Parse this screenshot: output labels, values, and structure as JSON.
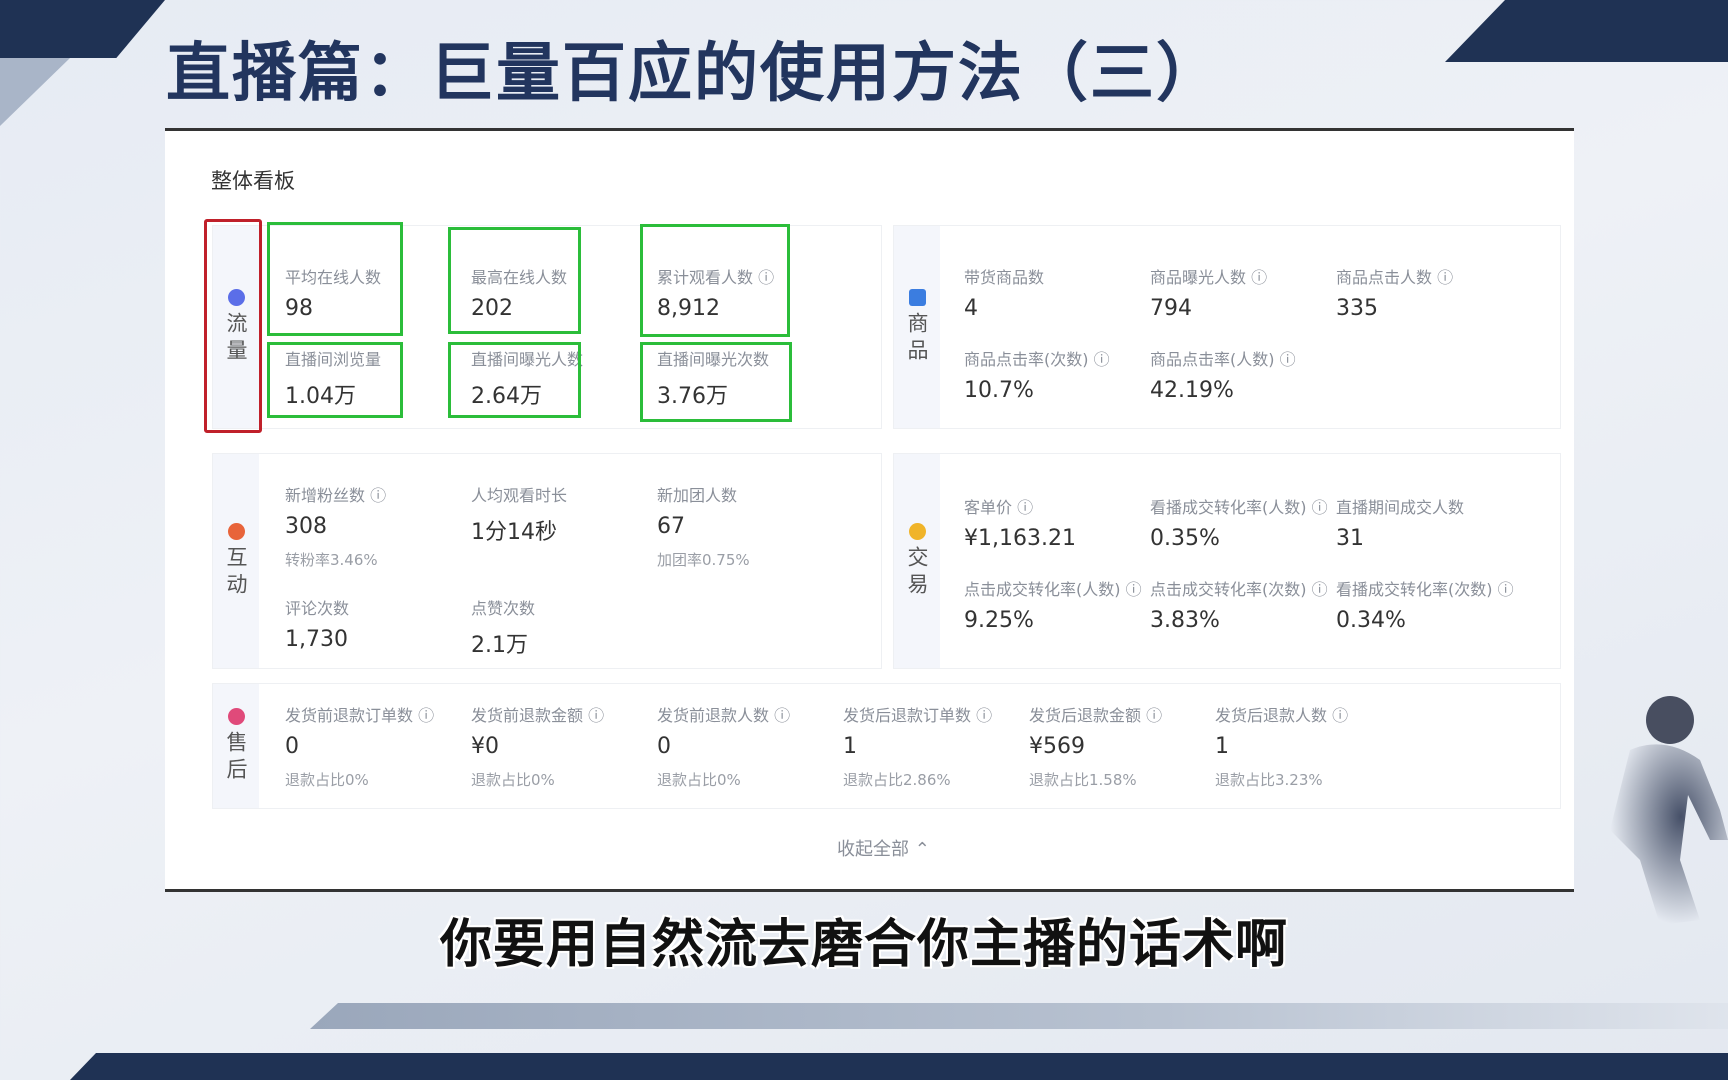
{
  "slide": {
    "title": "直播篇：巨量百应的使用方法（三）",
    "caption": "你要用自然流去磨合你主播的话术啊"
  },
  "dashboard": {
    "title": "整体看板",
    "collapse_label": "收起全部 ⌃",
    "traffic": {
      "category": "流量",
      "icon": "traffic-icon",
      "metrics": [
        {
          "label": "平均在线人数",
          "value": "98"
        },
        {
          "label": "最高在线人数",
          "value": "202"
        },
        {
          "label": "累计观看人数 ⓘ",
          "value": "8,912"
        },
        {
          "label": "直播间浏览量",
          "value": "1.04万"
        },
        {
          "label": "直播间曝光人数",
          "value": "2.64万"
        },
        {
          "label": "直播间曝光次数",
          "value": "3.76万"
        }
      ]
    },
    "products": {
      "category": "商品",
      "icon": "product-icon",
      "metrics": [
        {
          "label": "带货商品数",
          "value": "4"
        },
        {
          "label": "商品曝光人数 ⓘ",
          "value": "794"
        },
        {
          "label": "商品点击人数 ⓘ",
          "value": "335"
        },
        {
          "label": "商品点击率(次数) ⓘ",
          "value": "10.7%"
        },
        {
          "label": "商品点击率(人数) ⓘ",
          "value": "42.19%"
        }
      ]
    },
    "interaction": {
      "category": "互动",
      "icon": "interaction-icon",
      "metrics": [
        {
          "label": "新增粉丝数 ⓘ",
          "value": "308",
          "sub": "转粉率3.46%"
        },
        {
          "label": "人均观看时长",
          "value": "1分14秒"
        },
        {
          "label": "新加团人数",
          "value": "67",
          "sub": "加团率0.75%"
        },
        {
          "label": "评论次数",
          "value": "1,730"
        },
        {
          "label": "点赞次数",
          "value": "2.1万"
        }
      ]
    },
    "trade": {
      "category": "交易",
      "icon": "trade-icon",
      "metrics": [
        {
          "label": "客单价 ⓘ",
          "value": "¥1,163.21"
        },
        {
          "label": "看播成交转化率(人数) ⓘ",
          "value": "0.35%"
        },
        {
          "label": "直播期间成交人数",
          "value": "31"
        },
        {
          "label": "点击成交转化率(人数) ⓘ",
          "value": "9.25%"
        },
        {
          "label": "点击成交转化率(次数) ⓘ",
          "value": "3.83%"
        },
        {
          "label": "看播成交转化率(次数) ⓘ",
          "value": "0.34%"
        }
      ]
    },
    "aftersale": {
      "category": "售后",
      "icon": "aftersale-icon",
      "metrics": [
        {
          "label": "发货前退款订单数 ⓘ",
          "value": "0",
          "sub": "退款占比0%"
        },
        {
          "label": "发货前退款金额 ⓘ",
          "value": "¥0",
          "sub": "退款占比0%"
        },
        {
          "label": "发货前退款人数 ⓘ",
          "value": "0",
          "sub": "退款占比0%"
        },
        {
          "label": "发货后退款订单数 ⓘ",
          "value": "1",
          "sub": "退款占比2.86%"
        },
        {
          "label": "发货后退款金额 ⓘ",
          "value": "¥569",
          "sub": "退款占比1.58%"
        },
        {
          "label": "发货后退款人数 ⓘ",
          "value": "1",
          "sub": "退款占比3.23%"
        }
      ]
    }
  },
  "colors": {
    "title": "#22355e",
    "highlight_green": "#2bbd3a",
    "highlight_red": "#c0202a",
    "traffic_dot": "#5b6ee8",
    "product_dot": "#3b7de0",
    "interaction_dot": "#e8643a",
    "trade_dot": "#f0b429",
    "aftersale_dot": "#e04a7a"
  }
}
